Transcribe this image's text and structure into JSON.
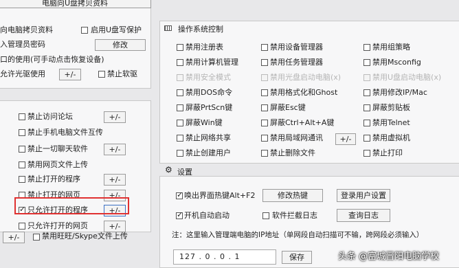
{
  "left_top": {
    "r0": "电脑向U盘拷贝资料",
    "r1": "向电脑拷贝资料",
    "r1b": "启用U盘写保护",
    "r2": "入管理员密码",
    "r2btn": "修改",
    "r3": "口的使用(可手动点击恢复设备)",
    "r4": "允许光驱使用",
    "r4btn": "+/-",
    "r4b": "禁止软驱"
  },
  "left_mid": {
    "items": [
      {
        "label": "禁止访问论坛",
        "btn": "+/-",
        "checked": false
      },
      {
        "label": "禁止手机电脑文件互传",
        "btn": "",
        "checked": false
      },
      {
        "label": "禁止一切聊天软件",
        "btn": "+/-",
        "checked": false
      },
      {
        "label": "禁用网页文件上传",
        "btn": "",
        "checked": false
      },
      {
        "label": "禁止打开的程序",
        "btn": "+/-",
        "checked": false
      },
      {
        "label": "禁止打开的网页",
        "btn": "+/-",
        "checked": false
      },
      {
        "label": "只允许打开的程序",
        "btn": "+/-",
        "checked": true
      },
      {
        "label": "只允许打开的网页",
        "btn": "+/-",
        "checked": false
      }
    ],
    "last_btn": "+/-",
    "last_label": "禁用旺旺/Skype文件上传"
  },
  "os": {
    "title": "操作系统控制",
    "col1": [
      "禁用注册表",
      "禁用计算机管理",
      "禁用安全模式",
      "禁用DOS命令",
      "屏蔽PrtScn键",
      "屏蔽Win键",
      "禁止网络共享",
      "禁止创建用户"
    ],
    "col2": [
      "禁用设备管理器",
      "禁用任务管理器",
      "禁用光盘启动电脑(x)",
      "禁用格式化和Ghost",
      "屏蔽Esc键",
      "屏蔽Ctrl+Alt+A键",
      "禁用局域网通讯",
      "禁止删除文件"
    ],
    "col3": [
      "禁用组策略",
      "禁用Msconfig",
      "禁用U盘启动电脑(x)",
      "禁用修改IP/Mac",
      "屏蔽剪贴板",
      "禁用Telnet",
      "禁用虚拟机",
      "禁止打印"
    ],
    "lan_btn": "+/-"
  },
  "settings": {
    "title": "设置",
    "hotkey_label": "唤出界面热键Alt+F2",
    "hotkey_btn": "修改热键",
    "login_btn": "登录用户设置",
    "autostart_label": "开机自动启动",
    "log_label": "软件拦截日志",
    "log_btn": "查询日志",
    "note": "注：这里输入管理端电脑的IP地址（单网段自动扫描可不输，跨网段必须输入）",
    "ip": "127 . 0 . 0 . 1",
    "save_btn": "保存"
  },
  "watermark": "头条 @富城晋阳电脑学校",
  "colors": {
    "highlight": "#e03030"
  }
}
